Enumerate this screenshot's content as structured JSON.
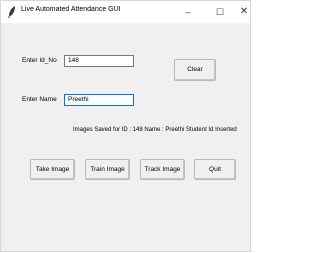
{
  "window": {
    "title": "Live Automated Attendance GUI",
    "controls": {
      "minimize": "–",
      "maximize": "☐",
      "close": "✕"
    }
  },
  "form": {
    "id_label": "Enter Id_No",
    "id_value": "148",
    "name_label": "Enter Name",
    "name_value": "Preethi"
  },
  "buttons": {
    "clear": "Clear",
    "take_image": "Take Image",
    "train_image": "Train Image",
    "track_image": "Track Image",
    "quit": "Quit"
  },
  "status": {
    "message": "Images Saved for ID : 148 Name : Preethi  Student Id Inserted"
  }
}
